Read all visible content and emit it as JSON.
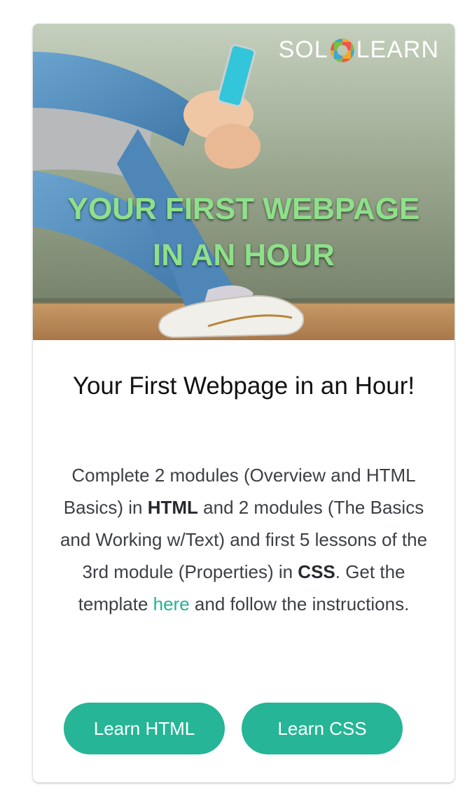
{
  "banner": {
    "logo_left": "SOL",
    "logo_right": "LEARN",
    "title": "YOUR FIRST WEBPAGE\nIN AN HOUR"
  },
  "card": {
    "title": "Your First Webpage in an Hour!",
    "description": {
      "p1": "Complete 2 modules (Overview and HTML Basics) in ",
      "b1": "HTML",
      "p2": " and 2 modules (The Basics and Working w/Text) and first 5 lessons of the 3rd module (Properties) in ",
      "b2": "CSS",
      "p3": ". Get the template ",
      "link": "here",
      "p4": " and follow the instructions."
    },
    "buttons": {
      "html": "Learn HTML",
      "css": "Learn CSS"
    }
  },
  "colors": {
    "accent": "#26b596",
    "link": "#27b095",
    "banner_title": "#8ee08a"
  }
}
